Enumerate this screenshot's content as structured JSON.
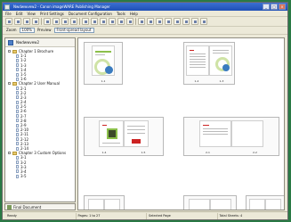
{
  "window": {
    "title": "Nwdwwvew2 - Canon imageWARE Publishing Manager"
  },
  "menubar": {
    "items": [
      "File",
      "Edit",
      "View",
      "Print Settings",
      "Document Configuration",
      "Tools",
      "Help"
    ]
  },
  "zoombar": {
    "zoom_label": "Zoom",
    "zoom_value": "100%",
    "preview_label": "Preview",
    "preview_value": "Front-spread layout"
  },
  "tree": {
    "root": "Nwdwwvew2",
    "chapters": [
      {
        "label": "Chapter 1 Brochure",
        "pages": [
          "1-1",
          "1-2",
          "1-3",
          "1-4",
          "1-5",
          "1-6"
        ]
      },
      {
        "label": "Chapter 2 User Manual",
        "pages": [
          "2-1",
          "2-2",
          "2-3",
          "2-4",
          "2-5",
          "2-6",
          "2-7",
          "2-8",
          "2-9",
          "2-10",
          "2-11",
          "2-12",
          "2-13",
          "2-14"
        ]
      },
      {
        "label": "Chapter 3 Custom Options",
        "pages": [
          "3-1",
          "3-2",
          "3-3",
          "3-4",
          "3-5"
        ]
      }
    ],
    "footer": "Final Document"
  },
  "spreads": [
    {
      "captions": [
        "1-1"
      ]
    },
    {
      "captions": [
        "1-2",
        "1-3"
      ]
    },
    {
      "captions": [
        "1-4",
        "1-5"
      ]
    },
    {
      "captions": [
        "2-1",
        "2-2"
      ]
    }
  ],
  "status": {
    "left": "Ready",
    "pages": "Pages: 1 to 27",
    "selected": "Selected Page",
    "total": "Total Sheets: 4"
  },
  "colors": {
    "desktop": "#2a7a45",
    "accent_green": "#8cc04b",
    "accent_blue": "#3a7bbf",
    "brand_red": "#cc2222"
  }
}
